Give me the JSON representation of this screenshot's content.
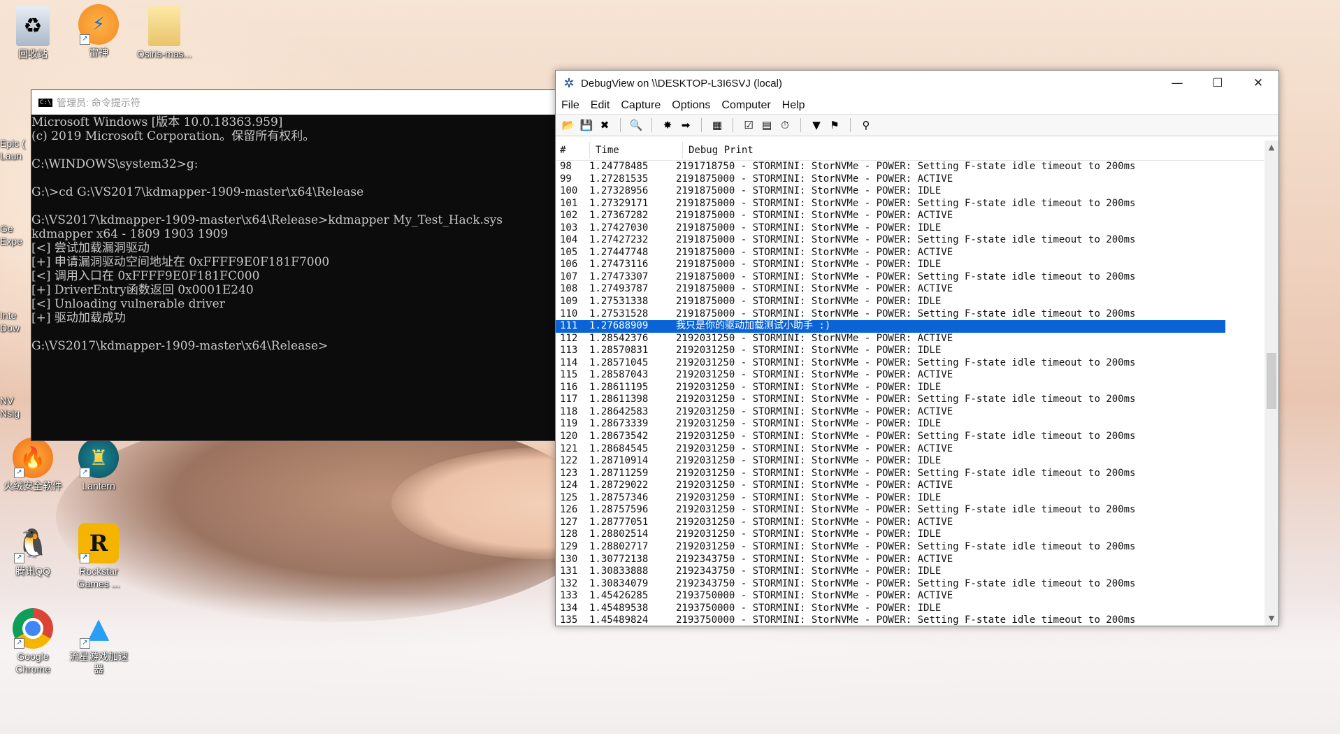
{
  "desktop": {
    "icons": [
      {
        "label": "回收站",
        "icon": "recycle-bin-icon"
      },
      {
        "label": "雷神",
        "icon": "leishen-app-icon"
      },
      {
        "label": "Osiris-mas...",
        "icon": "folder-icon"
      },
      {
        "label": "火绒安全软件",
        "icon": "huorong-flame-icon"
      },
      {
        "label": "Lantern",
        "icon": "lantern-app-icon"
      },
      {
        "label": "腾讯QQ",
        "icon": "qq-penguin-icon"
      },
      {
        "label": "Rockstar Games ...",
        "icon": "rockstar-games-icon"
      },
      {
        "label": "Google Chrome",
        "icon": "chrome-icon"
      },
      {
        "label": "流星游戏加速器",
        "icon": "meteor-accelerator-icon"
      }
    ],
    "partial_labels": [
      "Epic (",
      "Laun",
      "Ge",
      "Expe",
      "Inte",
      "Dow",
      "NV",
      "Nsig"
    ]
  },
  "cmd": {
    "title": "管理员: 命令提示符",
    "lines": [
      "Microsoft Windows [版本 10.0.18363.959]",
      "(c) 2019 Microsoft Corporation。保留所有权利。",
      "",
      "C:\\WINDOWS\\system32>g:",
      "",
      "G:\\>cd G:\\VS2017\\kdmapper-1909-master\\x64\\Release",
      "",
      "G:\\VS2017\\kdmapper-1909-master\\x64\\Release>kdmapper My_Test_Hack.sys",
      "kdmapper x64 - 1809 1903 1909",
      "[<] 尝试加载漏洞驱动",
      "[+] 申请漏洞驱动空间地址在 0xFFFF9E0F181F7000",
      "[<] 调用入口在 0xFFFF9E0F181FC000",
      "[+] DriverEntry函数返回 0x0001E240",
      "[<] Unloading vulnerable driver",
      "[+] 驱动加载成功",
      "",
      "G:\\VS2017\\kdmapper-1909-master\\x64\\Release>"
    ]
  },
  "debugview": {
    "title": "DebugView on \\\\DESKTOP-L3I6SVJ (local)",
    "menu": [
      "File",
      "Edit",
      "Capture",
      "Options",
      "Computer",
      "Help"
    ],
    "toolbar": [
      {
        "icon": "open-folder-icon"
      },
      {
        "icon": "save-icon"
      },
      {
        "icon": "clear-icon"
      },
      {
        "sep": true
      },
      {
        "icon": "find-icon"
      },
      {
        "sep": true
      },
      {
        "icon": "capture-icon"
      },
      {
        "icon": "autoscroll-icon"
      },
      {
        "sep": true
      },
      {
        "icon": "capture-kernel-icon"
      },
      {
        "sep": true
      },
      {
        "icon": "history-icon"
      },
      {
        "icon": "filter-icon"
      },
      {
        "icon": "time-icon"
      },
      {
        "sep": true
      },
      {
        "icon": "highlight-icon"
      },
      {
        "icon": "bookmark-icon"
      },
      {
        "sep": true
      },
      {
        "icon": "binoculars-icon"
      }
    ],
    "columns": [
      "#",
      "Time",
      "Debug Print"
    ],
    "selected_row": 111,
    "rows": [
      [
        "98",
        "1.24778485",
        "2191718750 - STORMINI: StorNVMe - POWER: Setting F-state idle timeout to 200ms"
      ],
      [
        "99",
        "1.27281535",
        "2191875000 - STORMINI: StorNVMe - POWER: ACTIVE"
      ],
      [
        "100",
        "1.27328956",
        "2191875000 - STORMINI: StorNVMe - POWER: IDLE"
      ],
      [
        "101",
        "1.27329171",
        "2191875000 - STORMINI: StorNVMe - POWER: Setting F-state idle timeout to 200ms"
      ],
      [
        "102",
        "1.27367282",
        "2191875000 - STORMINI: StorNVMe - POWER: ACTIVE"
      ],
      [
        "103",
        "1.27427030",
        "2191875000 - STORMINI: StorNVMe - POWER: IDLE"
      ],
      [
        "104",
        "1.27427232",
        "2191875000 - STORMINI: StorNVMe - POWER: Setting F-state idle timeout to 200ms"
      ],
      [
        "105",
        "1.27447748",
        "2191875000 - STORMINI: StorNVMe - POWER: ACTIVE"
      ],
      [
        "106",
        "1.27473116",
        "2191875000 - STORMINI: StorNVMe - POWER: IDLE"
      ],
      [
        "107",
        "1.27473307",
        "2191875000 - STORMINI: StorNVMe - POWER: Setting F-state idle timeout to 200ms"
      ],
      [
        "108",
        "1.27493787",
        "2191875000 - STORMINI: StorNVMe - POWER: ACTIVE"
      ],
      [
        "109",
        "1.27531338",
        "2191875000 - STORMINI: StorNVMe - POWER: IDLE"
      ],
      [
        "110",
        "1.27531528",
        "2191875000 - STORMINI: StorNVMe - POWER: Setting F-state idle timeout to 200ms"
      ],
      [
        "111",
        "1.27688909",
        "我只是你的驱动加载测试小助手 :)"
      ],
      [
        "112",
        "1.28542376",
        "2192031250 - STORMINI: StorNVMe - POWER: ACTIVE"
      ],
      [
        "113",
        "1.28570831",
        "2192031250 - STORMINI: StorNVMe - POWER: IDLE"
      ],
      [
        "114",
        "1.28571045",
        "2192031250 - STORMINI: StorNVMe - POWER: Setting F-state idle timeout to 200ms"
      ],
      [
        "115",
        "1.28587043",
        "2192031250 - STORMINI: StorNVMe - POWER: ACTIVE"
      ],
      [
        "116",
        "1.28611195",
        "2192031250 - STORMINI: StorNVMe - POWER: IDLE"
      ],
      [
        "117",
        "1.28611398",
        "2192031250 - STORMINI: StorNVMe - POWER: Setting F-state idle timeout to 200ms"
      ],
      [
        "118",
        "1.28642583",
        "2192031250 - STORMINI: StorNVMe - POWER: ACTIVE"
      ],
      [
        "119",
        "1.28673339",
        "2192031250 - STORMINI: StorNVMe - POWER: IDLE"
      ],
      [
        "120",
        "1.28673542",
        "2192031250 - STORMINI: StorNVMe - POWER: Setting F-state idle timeout to 200ms"
      ],
      [
        "121",
        "1.28684545",
        "2192031250 - STORMINI: StorNVMe - POWER: ACTIVE"
      ],
      [
        "122",
        "1.28710914",
        "2192031250 - STORMINI: StorNVMe - POWER: IDLE"
      ],
      [
        "123",
        "1.28711259",
        "2192031250 - STORMINI: StorNVMe - POWER: Setting F-state idle timeout to 200ms"
      ],
      [
        "124",
        "1.28729022",
        "2192031250 - STORMINI: StorNVMe - POWER: ACTIVE"
      ],
      [
        "125",
        "1.28757346",
        "2192031250 - STORMINI: StorNVMe - POWER: IDLE"
      ],
      [
        "126",
        "1.28757596",
        "2192031250 - STORMINI: StorNVMe - POWER: Setting F-state idle timeout to 200ms"
      ],
      [
        "127",
        "1.28777051",
        "2192031250 - STORMINI: StorNVMe - POWER: ACTIVE"
      ],
      [
        "128",
        "1.28802514",
        "2192031250 - STORMINI: StorNVMe - POWER: IDLE"
      ],
      [
        "129",
        "1.28802717",
        "2192031250 - STORMINI: StorNVMe - POWER: Setting F-state idle timeout to 200ms"
      ],
      [
        "130",
        "1.30772138",
        "2192343750 - STORMINI: StorNVMe - POWER: ACTIVE"
      ],
      [
        "131",
        "1.30833888",
        "2192343750 - STORMINI: StorNVMe - POWER: IDLE"
      ],
      [
        "132",
        "1.30834079",
        "2192343750 - STORMINI: StorNVMe - POWER: Setting F-state idle timeout to 200ms"
      ],
      [
        "133",
        "1.45426285",
        "2193750000 - STORMINI: StorNVMe - POWER: ACTIVE"
      ],
      [
        "134",
        "1.45489538",
        "2193750000 - STORMINI: StorNVMe - POWER: IDLE"
      ],
      [
        "135",
        "1.45489824",
        "2193750000 - STORMINI: StorNVMe - POWER: Setting F-state idle timeout to 200ms"
      ]
    ]
  },
  "colors": {
    "selection": "#0a64d6",
    "cmd_bg": "#0c0c0c",
    "cmd_fg": "#c8c8c8"
  }
}
